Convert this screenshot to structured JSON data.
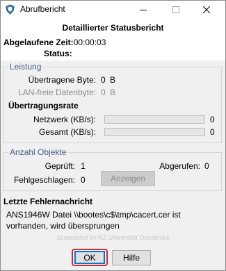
{
  "window": {
    "title": "Abrufbericht",
    "icon": "shield-app-icon"
  },
  "header": {
    "heading": "Detaillierter Statusbericht",
    "elapsed_label": "Abgelaufene Zeit:",
    "elapsed_value": "00:00:03",
    "status_label": "Status:",
    "status_value": ""
  },
  "performance": {
    "group_title": "Leistung",
    "transferred_label": "Übertragene Byte:",
    "transferred_value": "0",
    "transferred_unit": "B",
    "lanfree_label": "LAN-freie Datenbyte:",
    "lanfree_value": "0",
    "lanfree_unit": "B",
    "rate_title": "Übertragungsrate",
    "network_label": "Netzwerk (KB/s):",
    "network_value": "0",
    "network_fill": 0,
    "total_label": "Gesamt (KB/s):",
    "total_value": "0",
    "total_fill": 0
  },
  "objects": {
    "group_title": "Anzahl Objekte",
    "checked_label": "Geprüft:",
    "checked_value": "1",
    "retrieved_label": "Abgerufen:",
    "retrieved_value": "0",
    "failed_label": "Fehlgeschlagen:",
    "failed_value": "0",
    "show_button": "Anzeigen"
  },
  "error": {
    "title": "Letzte Fehlernachricht",
    "message": "ANS1946W Datei \\\\bootes\\c$\\tmp\\cacert.cer ist vorhanden, wird übersprungen",
    "watermark": "Screenshot by RZ Universität Osnabrück"
  },
  "buttons": {
    "ok": "OK",
    "help": "Hilfe"
  }
}
